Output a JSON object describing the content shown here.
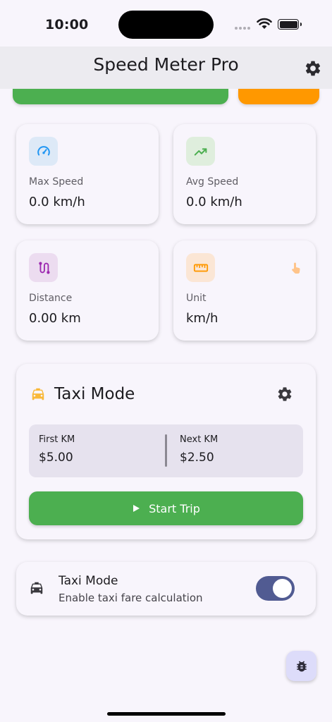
{
  "status_bar": {
    "time": "10:00"
  },
  "app_bar": {
    "title": "Speed Meter Pro",
    "settings_icon": "gear-icon"
  },
  "colors": {
    "accent_green": "#4caf50",
    "accent_orange": "#ff9800",
    "switch_track": "#515b92",
    "max_speed_icon": "#2196f3",
    "avg_speed_icon": "#4caf50",
    "distance_icon": "#9c27b0",
    "unit_icon": "#ff9800"
  },
  "stats": {
    "max_speed": {
      "label": "Max Speed",
      "value": "0.0 km/h",
      "icon": "speedometer-icon"
    },
    "avg_speed": {
      "label": "Avg Speed",
      "value": "0.0 km/h",
      "icon": "trending-up-icon"
    },
    "distance": {
      "label": "Distance",
      "value": "0.00 km",
      "icon": "route-icon"
    },
    "unit": {
      "label": "Unit",
      "value": "km/h",
      "icon": "ruler-icon",
      "hint_icon": "touch-icon"
    }
  },
  "taxi_card": {
    "title": "Taxi Mode",
    "icon": "taxi-icon",
    "settings_icon": "gear-icon",
    "first_km_label": "First KM",
    "first_km_value": "$5.00",
    "next_km_label": "Next KM",
    "next_km_value": "$2.50",
    "start_button": "Start Trip",
    "start_icon": "play-icon"
  },
  "taxi_toggle": {
    "title": "Taxi Mode",
    "subtitle": "Enable taxi fare calculation",
    "icon": "car-icon",
    "enabled": true
  },
  "debug_button": {
    "icon": "bug-icon"
  }
}
